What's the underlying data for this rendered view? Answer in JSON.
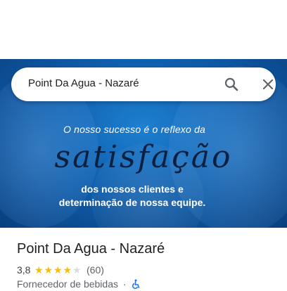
{
  "search": {
    "query": "Point Da Agua - Nazaré"
  },
  "hero": {
    "line1": "O nosso sucesso é o reflexo da",
    "script_word": "satisfação",
    "line2a": "dos nossos clientes e",
    "line2b": "determinação de nossa equipe."
  },
  "place": {
    "title": "Point Da Agua - Nazaré",
    "rating": "3,8",
    "stars_filled": 4,
    "stars_total": 5,
    "review_count": "(60)",
    "category": "Fornecedor de bebidas",
    "separator": "·"
  },
  "colors": {
    "star_on": "#fbbc04",
    "star_off": "#dadce0",
    "hero_blue": "#0f5fae",
    "accessibility_blue": "#1a73e8"
  },
  "icons": {
    "search": "search-icon",
    "close": "close-icon",
    "accessibility": "wheelchair-icon"
  }
}
